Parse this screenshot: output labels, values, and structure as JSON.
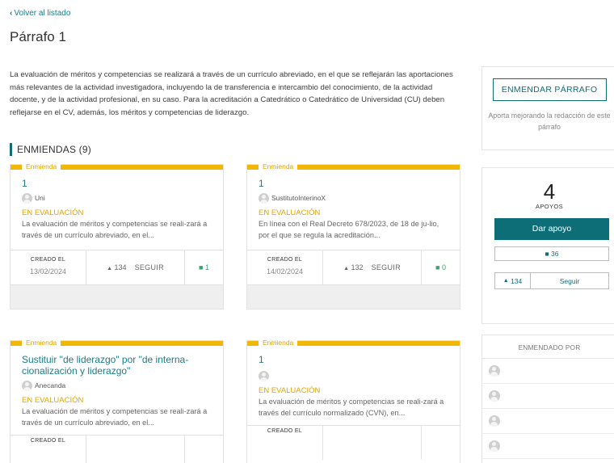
{
  "nav": {
    "back_label": "Volver al listado"
  },
  "page": {
    "title": "Párrafo 1",
    "paragraph": "La evaluación de méritos y competencias se realizará a través de un currículo abreviado, en el que se reflejarán las aportaciones más relevantes de la actividad investigadora, incluyendo la de transferencia e intercambio del conocimiento, de la actividad docente, y de la actividad profesional, en su caso. Para la acreditación a Catedrático o Catedrático de Universidad (CU) deben reflejarse en el CV, además, los méritos y competencias de liderazgo."
  },
  "amendments": {
    "section_title": "ENMIENDAS (9)",
    "tag_label": "Enmienda",
    "created_label": "CREADO EL",
    "follow_label": "SEGUIR",
    "items": [
      {
        "title": "1",
        "author": "Uni",
        "status": "EN EVALUACIÓN",
        "excerpt": "La evaluación de méritos y competencias se reali-zará a través de un currículo abreviado, en el...",
        "date": "13/02/2024",
        "votes": "134",
        "comments": "1"
      },
      {
        "title": "1",
        "author": "SustitutoInterinoX",
        "status": "EN EVALUACIÓN",
        "excerpt": "En línea con el Real Decreto 678/2023, de 18 de ju-lio, por el que se regula la acreditación...",
        "date": "14/02/2024",
        "votes": "132",
        "comments": "0"
      },
      {
        "title": "Sustituir \"de liderazgo\" por \"de interna-cionalización y liderazgo\"",
        "author": "Anecanda",
        "status": "EN EVALUACIÓN",
        "excerpt": "La evaluación de méritos y competencias se reali-zará a través de un currículo abreviado, en el..."
      },
      {
        "title": "1",
        "author": "",
        "status": "EN EVALUACIÓN",
        "excerpt": "La evaluación de méritos y competencias se reali-zará a través del currículo normalizado (CVN), en..."
      }
    ]
  },
  "sidebar": {
    "amend_button": "ENMENDAR PÁRRAFO",
    "amend_help": "Aporta mejorando la redacción de este párrafo",
    "support_count": "4",
    "support_label": "APOYOS",
    "support_button": "Dar apoyo",
    "comments_count": "36",
    "follow_votes": "134",
    "follow_button": "Seguir",
    "amended_by_title": "ENMENDADO POR"
  },
  "colors": {
    "accent": "#0e6e78",
    "tag": "#f2b705",
    "link": "#1b7c8a",
    "comment": "#3aa36f"
  }
}
